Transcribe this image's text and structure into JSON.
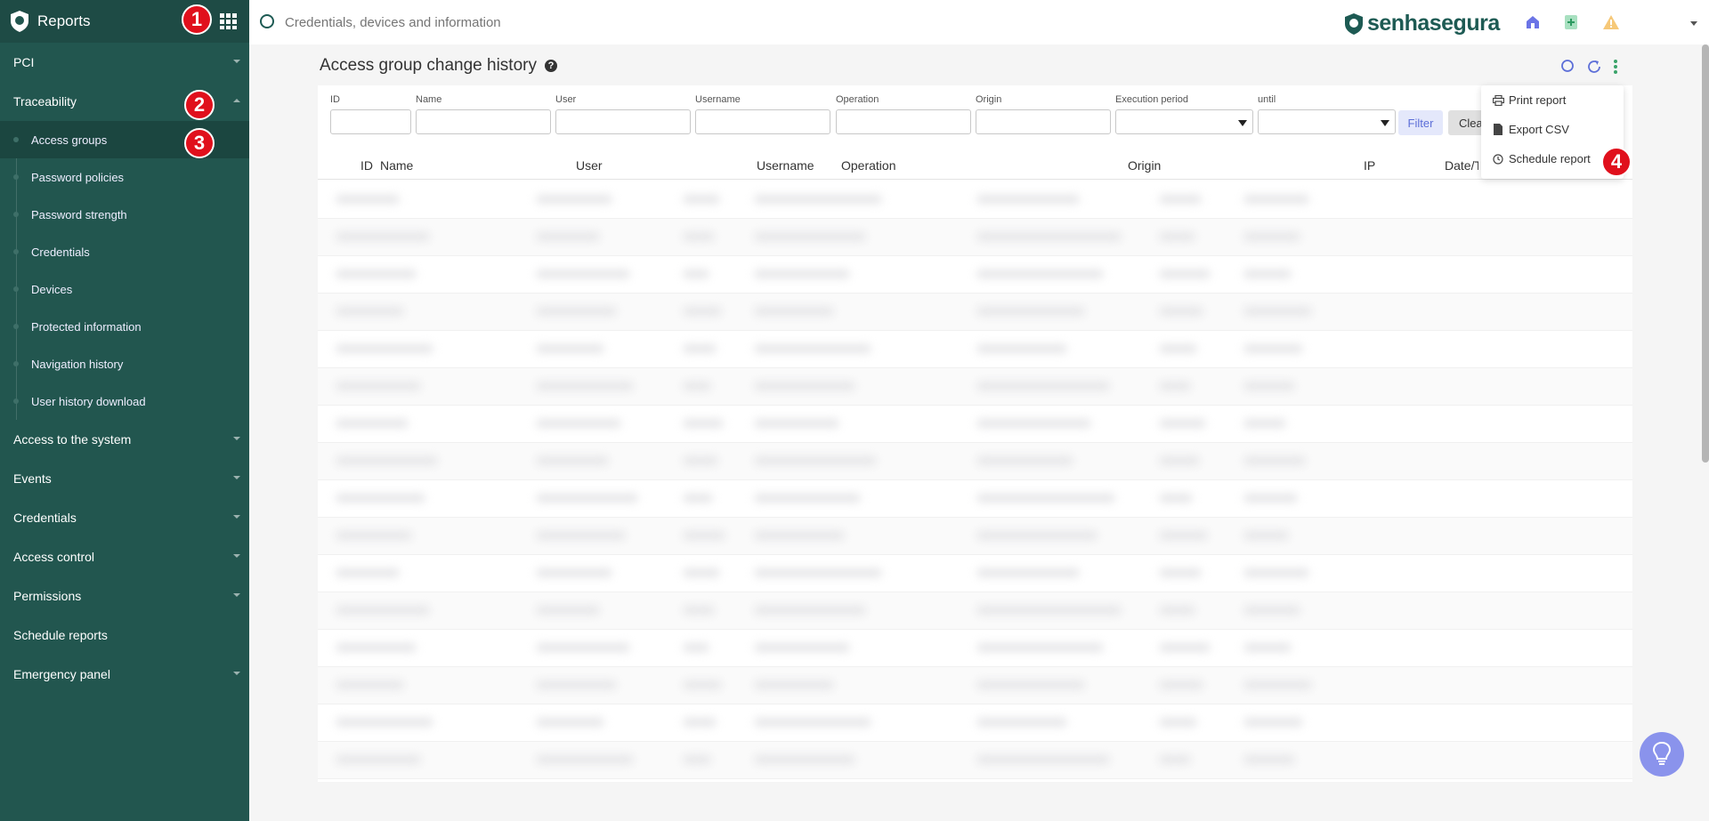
{
  "sidebar": {
    "title": "Reports",
    "items_top": [
      {
        "label": "PCI"
      }
    ],
    "traceability": {
      "label": "Traceability"
    },
    "sub_items": [
      {
        "label": "Access groups"
      },
      {
        "label": "Password policies"
      },
      {
        "label": "Password strength"
      },
      {
        "label": "Credentials"
      },
      {
        "label": "Devices"
      },
      {
        "label": "Protected information"
      },
      {
        "label": "Navigation history"
      },
      {
        "label": "User history download"
      }
    ],
    "items_bottom": [
      {
        "label": "Access to the system"
      },
      {
        "label": "Events"
      },
      {
        "label": "Credentials"
      },
      {
        "label": "Access control"
      },
      {
        "label": "Permissions"
      },
      {
        "label": "Schedule reports"
      },
      {
        "label": "Emergency panel"
      }
    ]
  },
  "search": {
    "placeholder": "Credentials, devices and information"
  },
  "brand": {
    "name": "senhasegura"
  },
  "page": {
    "title": "Access group change history",
    "help": "?"
  },
  "filters": {
    "labels": [
      "ID",
      "Name",
      "User",
      "Username",
      "Operation",
      "Origin",
      "Execution period",
      "until"
    ],
    "filter_button": "Filter",
    "clear_button": "Clear"
  },
  "table": {
    "headers": [
      "ID",
      "Name",
      "User",
      "Username",
      "Operation",
      "Origin",
      "IP",
      "Date/Time"
    ]
  },
  "menu": {
    "items": [
      {
        "label": "Print report",
        "icon": "printer-icon"
      },
      {
        "label": "Export CSV",
        "icon": "file-icon"
      },
      {
        "label": "Schedule report",
        "icon": "clock-icon"
      }
    ]
  },
  "markers": [
    "1",
    "2",
    "3",
    "4"
  ],
  "colors": {
    "sidebar": "#22564f",
    "accent": "#5d6fd8",
    "marker": "#e0101c"
  }
}
